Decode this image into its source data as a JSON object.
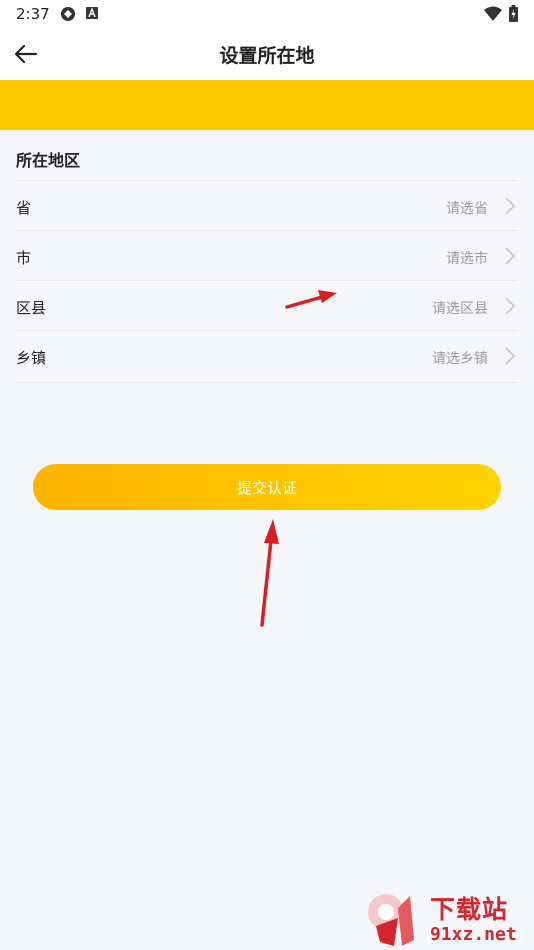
{
  "status_bar": {
    "time": "2:37",
    "icons": [
      "sync-icon",
      "accessibility-a-icon",
      "wifi-icon",
      "battery-charging-icon"
    ]
  },
  "header": {
    "title": "设置所在地",
    "back_icon": "arrow-left-icon"
  },
  "colors": {
    "accent": "#fcc800",
    "background": "#f5f6fa",
    "annotation_arrow": "#e02020"
  },
  "region": {
    "section_title": "所在地区",
    "rows": [
      {
        "label": "省",
        "placeholder": "请选省"
      },
      {
        "label": "市",
        "placeholder": "请选市"
      },
      {
        "label": "区县",
        "placeholder": "请选区县"
      },
      {
        "label": "乡镇",
        "placeholder": "请选乡镇"
      }
    ]
  },
  "submit": {
    "label": "提交认证"
  },
  "watermark": {
    "title": "下载站",
    "url": "91xz.net"
  }
}
